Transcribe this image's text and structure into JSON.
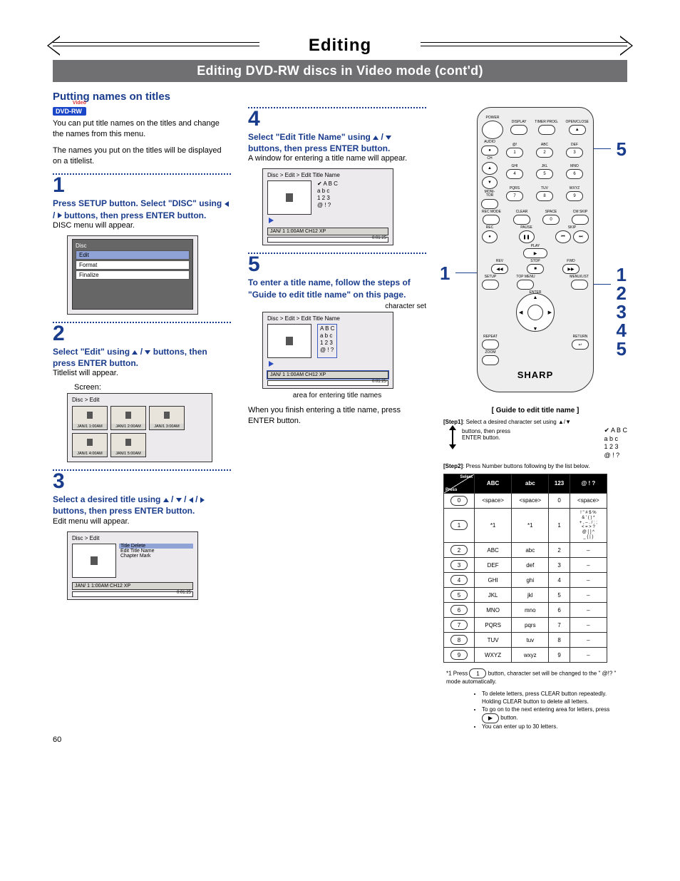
{
  "header": {
    "title": "Editing",
    "sub": "Editing DVD-RW discs in Video mode (cont'd)"
  },
  "section_title": "Putting names on titles",
  "badge": {
    "text": "DVD-RW",
    "tag": "Video"
  },
  "intro1": "You can put title names on the titles and change the names from this menu.",
  "intro2": "The names you put on the titles will be displayed on a titlelist.",
  "steps": {
    "s1": {
      "num": "1",
      "bold": "Press SETUP button. Select \"DISC\" using ◀ / ▶ buttons, then press ENTER button.",
      "note": "DISC menu will appear."
    },
    "s2": {
      "num": "2",
      "bold": "Select \"Edit\" using ▲ / ▼ buttons, then press ENTER button.",
      "note": "Titlelist will appear.",
      "screen_label": "Screen:"
    },
    "s3": {
      "num": "3",
      "bold": "Select a desired title using ▲ / ▼ / ◀ / ▶ buttons, then press ENTER button.",
      "note": "Edit menu will appear."
    },
    "s4": {
      "num": "4",
      "bold": "Select \"Edit Title Name\" using ▲ / ▼ buttons, then press ENTER button.",
      "note": "A window for entering a title name will appear."
    },
    "s5": {
      "num": "5",
      "bold": "To enter a title name, follow the steps of \"Guide to edit title name\" on this page.",
      "annot_charset": "character set",
      "annot_area": "area for entering title names",
      "final": "When you finish entering a title name, press ENTER button."
    }
  },
  "disc_menu": {
    "title": "Disc",
    "items": [
      "Edit",
      "Format",
      "Finalize"
    ]
  },
  "titlelist": {
    "crumb": "Disc > Edit",
    "items": [
      {
        "cap": "JAN/1  1:00AM"
      },
      {
        "cap": "JAN/1  2:00AM"
      },
      {
        "cap": "JAN/1  3:00AM"
      },
      {
        "cap": "JAN/1  4:00AM"
      },
      {
        "cap": "JAN/1  5:00AM"
      }
    ]
  },
  "editmenu": {
    "crumb": "Disc > Edit",
    "items": [
      "Title Delete",
      "Edit Title Name",
      "Chapter Mark"
    ],
    "status": "JAN/ 1   1:00AM  CH12    XP",
    "bartime": "0:01:25"
  },
  "titlename": {
    "crumb": "Disc > Edit > Edit Title Name",
    "charset": [
      "A B C",
      "a b c",
      "1 2 3",
      "@ ! ?"
    ],
    "status": "JAN/ 1   1:00AM   CH12   XP",
    "bartime": "0:01:25"
  },
  "remote": {
    "brand": "SHARP",
    "callouts_right": [
      "1",
      "2",
      "3",
      "4",
      "5"
    ],
    "callout_top_right": "5",
    "callout_left": "1",
    "labels": {
      "power": "POWER",
      "open": "OPEN/CLOSE",
      "display": "DISPLAY",
      "timer": "TIMER PROG.",
      "rec": "REC",
      "recmode": "REC MODE",
      "clear": "CLEAR",
      "space": "SPACE",
      "cmskip": "CM SKIP",
      "pause": "PAUSE",
      "skip": "SKIP",
      "play": "PLAY",
      "stop": "STOP",
      "rev": "REV",
      "fwd": "FWD",
      "setup": "SETUP",
      "topmenu": "TOP MENU",
      "menulist": "MENU/LIST",
      "enter": "ENTER",
      "repeat": "REPEAT",
      "return": "RETURN",
      "zoom": "ZOOM",
      "ch": "CH",
      "audio": "AUDIO",
      "monitor": "MONI-TOR"
    },
    "keypad": [
      {
        "n": "1",
        "t": "@!"
      },
      {
        "n": "2",
        "t": "ABC"
      },
      {
        "n": "3",
        "t": "DEF"
      },
      {
        "n": "4",
        "t": "GHI"
      },
      {
        "n": "5",
        "t": "JKL"
      },
      {
        "n": "6",
        "t": "MNO"
      },
      {
        "n": "7",
        "t": "PQRS"
      },
      {
        "n": "8",
        "t": "TUV"
      },
      {
        "n": "9",
        "t": "WXYZ"
      },
      {
        "n": "",
        "t": ""
      },
      {
        "n": "0",
        "t": ""
      },
      {
        "n": "",
        "t": ""
      }
    ]
  },
  "guide": {
    "title": "[ Guide to edit title name ]",
    "step1_label": "[Step1]",
    "step1_text": ": Select a desired character set using ▲/▼ buttons, then press ENTER button.",
    "charset": [
      "A B C",
      "a b c",
      "1 2 3",
      "@ ! ?"
    ],
    "step2_label": "[Step2]",
    "step2_text": ": Press Number buttons following by the list below.",
    "table_head": [
      "ABC",
      "abc",
      "123",
      "@ ! ?"
    ],
    "corner": {
      "select": "Select",
      "press": "Press"
    },
    "rows": [
      {
        "k": "0",
        "c": [
          "<space>",
          "<space>",
          "0",
          "<space>"
        ]
      },
      {
        "k": "1",
        "c": [
          "*1",
          "*1",
          "1",
          "! \" # $ %\n& ' ( ) *\n+ , – . / : ;\n< = > ?\n@ [ ] ^\n_ { | }"
        ]
      },
      {
        "k": "2",
        "c": [
          "ABC",
          "abc",
          "2",
          "–"
        ]
      },
      {
        "k": "3",
        "c": [
          "DEF",
          "def",
          "3",
          "–"
        ]
      },
      {
        "k": "4",
        "c": [
          "GHI",
          "ghi",
          "4",
          "–"
        ]
      },
      {
        "k": "5",
        "c": [
          "JKL",
          "jkl",
          "5",
          "–"
        ]
      },
      {
        "k": "6",
        "c": [
          "MNO",
          "mno",
          "6",
          "–"
        ]
      },
      {
        "k": "7",
        "c": [
          "PQRS",
          "pqrs",
          "7",
          "–"
        ]
      },
      {
        "k": "8",
        "c": [
          "TUV",
          "tuv",
          "8",
          "–"
        ]
      },
      {
        "k": "9",
        "c": [
          "WXYZ",
          "wxyz",
          "9",
          "–"
        ]
      }
    ],
    "star": "*1 Press 1 button, character set will be changed to the \" @!? \" mode automatically.",
    "notes": [
      "To delete letters, press CLEAR button repeatedly. Holding CLEAR button to delete all letters.",
      "To go on to the next entering area for letters, press ▶ button.",
      "You can enter up to 30 letters."
    ]
  },
  "pagenum": "60"
}
